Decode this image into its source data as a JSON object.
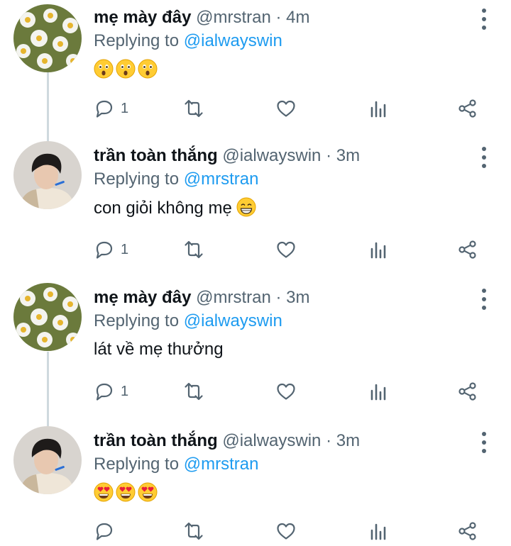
{
  "tweets": [
    {
      "name": "mẹ mày đây",
      "handle": "@mrstran",
      "separator": "·",
      "time": "4m",
      "reply_prefix": "Replying to",
      "reply_to": "@ialwayswin",
      "text": "",
      "emoji": [
        "astonished-face",
        "astonished-face",
        "astonished-face"
      ],
      "reply_count": "1",
      "avatar": "daisy-flowers-photo"
    },
    {
      "name": "trần toàn thắng",
      "handle": "@ialwayswin",
      "separator": "·",
      "time": "3m",
      "reply_prefix": "Replying to",
      "reply_to": "@mrstran",
      "text": "con giỏi không mẹ",
      "emoji": [
        "grinning-face"
      ],
      "reply_count": "1",
      "avatar": "young-man-photo"
    },
    {
      "name": "mẹ mày đây",
      "handle": "@mrstran",
      "separator": "·",
      "time": "3m",
      "reply_prefix": "Replying to",
      "reply_to": "@ialwayswin",
      "text": "lát về mẹ thưởng",
      "emoji": [],
      "reply_count": "1",
      "avatar": "daisy-flowers-photo"
    },
    {
      "name": "trần toàn thắng",
      "handle": "@ialwayswin",
      "separator": "·",
      "time": "3m",
      "reply_prefix": "Replying to",
      "reply_to": "@mrstran",
      "text": "",
      "emoji": [
        "heart-eyes-face",
        "heart-eyes-face",
        "heart-eyes-face"
      ],
      "reply_count": "",
      "avatar": "young-man-photo"
    }
  ],
  "action_icons": [
    "reply-icon",
    "retweet-icon",
    "like-icon",
    "analytics-icon",
    "share-icon"
  ],
  "colors": {
    "text": "#0f1419",
    "secondary": "#536471",
    "mention": "#1d9bf0",
    "thread_line": "#cfd9de"
  }
}
